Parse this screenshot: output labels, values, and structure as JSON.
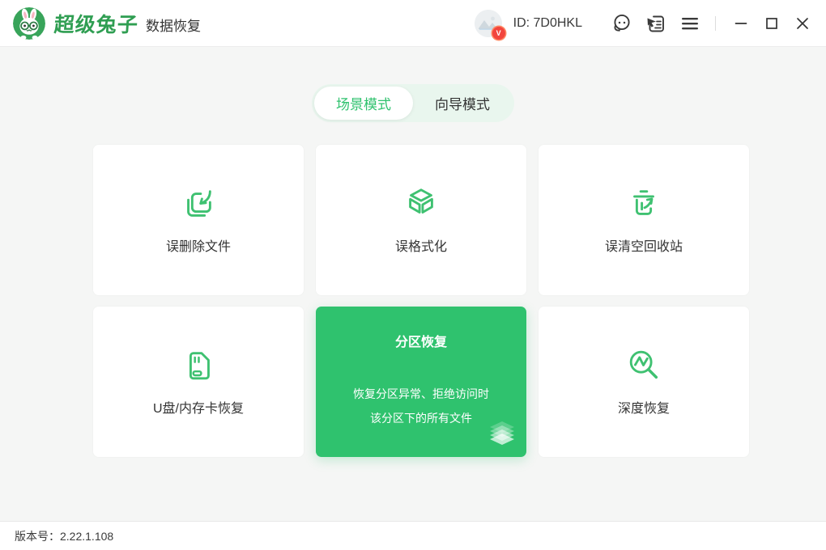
{
  "colors": {
    "primary": "#2fc26e",
    "icon-green": "#3fc171",
    "title-green": "#2f9e52",
    "logo-green": "#38a45a",
    "tab-bg": "#e9f6ee",
    "text-dark": "#333333",
    "page-bg": "#f5f6f5",
    "badge-red": "#f2453d"
  },
  "header": {
    "app_title": "超级兔子",
    "app_subtitle": "数据恢复",
    "user_id": "ID: 7D0HKL",
    "avatar_badge": "V",
    "icons": [
      "rabbit-logo-icon",
      "avatar",
      "customer-service-icon",
      "feedback-icon",
      "menu-icon",
      "minimize-icon",
      "maximize-icon",
      "close-icon"
    ]
  },
  "tabs": [
    {
      "label": "场景模式",
      "active": true
    },
    {
      "label": "向导模式",
      "active": false
    }
  ],
  "cards": [
    {
      "label": "误删除文件",
      "icon": "file-restore-icon"
    },
    {
      "label": "误格式化",
      "icon": "format-cube-icon"
    },
    {
      "label": "误清空回收站",
      "icon": "recycle-restore-icon"
    },
    {
      "label": "U盘/内存卡恢复",
      "icon": "memory-card-icon"
    },
    {
      "label": "分区恢复",
      "icon": "partition-layers-icon",
      "active": true,
      "description": [
        "恢复分区异常、拒绝访问时",
        "该分区下的所有文件"
      ]
    },
    {
      "label": "深度恢复",
      "icon": "deep-scan-icon"
    }
  ],
  "footer": {
    "version_label": "版本号：2.22.1.108"
  }
}
